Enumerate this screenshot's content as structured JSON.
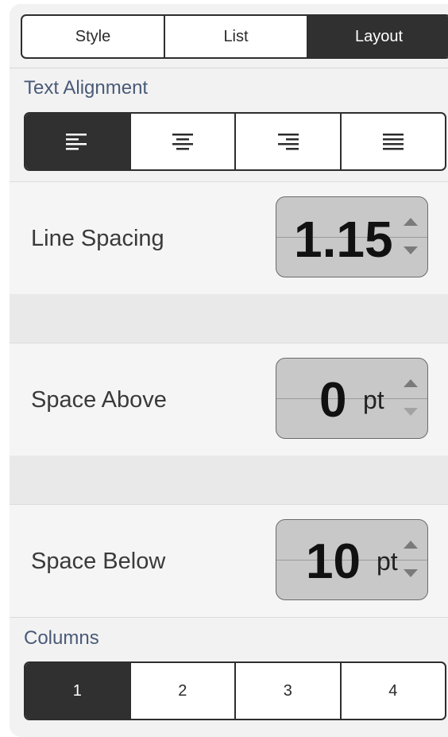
{
  "tabs": [
    {
      "label": "Style",
      "active": false
    },
    {
      "label": "List",
      "active": false
    },
    {
      "label": "Layout",
      "active": true
    }
  ],
  "text_alignment": {
    "label": "Text Alignment",
    "options": [
      {
        "icon": "align-left-icon",
        "active": true
      },
      {
        "icon": "align-center-icon",
        "active": false
      },
      {
        "icon": "align-right-icon",
        "active": false
      },
      {
        "icon": "align-justify-icon",
        "active": false
      }
    ]
  },
  "line_spacing": {
    "label": "Line Spacing",
    "value": "1.15",
    "unit": ""
  },
  "space_above": {
    "label": "Space Above",
    "value": "0",
    "unit": "pt"
  },
  "space_below": {
    "label": "Space Below",
    "value": "10",
    "unit": "pt"
  },
  "columns": {
    "label": "Columns",
    "options": [
      "1",
      "2",
      "3",
      "4"
    ],
    "selected": "1"
  },
  "colors": {
    "active_segment": "#303030",
    "section_label": "#4a5a78"
  }
}
